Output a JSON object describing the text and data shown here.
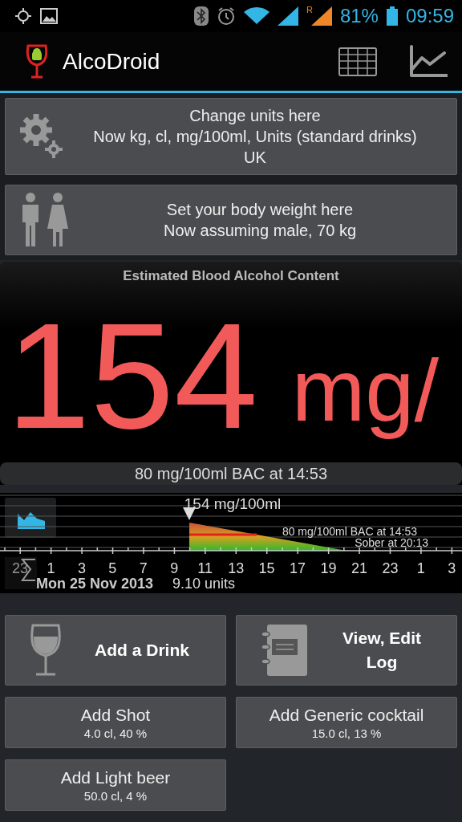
{
  "status_bar": {
    "roaming_mark": "R",
    "battery": "81%",
    "time": "09:59"
  },
  "action_bar": {
    "title": "AlcoDroid"
  },
  "settings": [
    {
      "kind": "units",
      "lines": [
        "Change units here",
        "Now kg, cl, mg/100ml, Units (standard drinks)",
        "UK"
      ]
    },
    {
      "kind": "body",
      "lines": [
        "Set your body weight here",
        "Now assuming male, 70 kg"
      ]
    }
  ],
  "bac": {
    "title": "Estimated Blood Alcohol Content",
    "value": "154",
    "unit": "mg/",
    "footer": "80 mg/100ml BAC at 14:53"
  },
  "timeline": {
    "peak_label": "154 mg/100ml",
    "limit_label": "80 mg/100ml BAC at 14:53",
    "sober_label": "Sober at 20:13",
    "hours": [
      "23",
      "1",
      "3",
      "5",
      "7",
      "9",
      "11",
      "13",
      "15",
      "17",
      "19",
      "21",
      "23",
      "1",
      "3"
    ],
    "date": "Mon 25 Nov 2013",
    "units": "9.10 units"
  },
  "actions": [
    {
      "kind": "drink",
      "label": "Add a Drink"
    },
    {
      "kind": "log",
      "label": "View, Edit Log"
    }
  ],
  "presets": [
    {
      "name": "Add Shot",
      "detail": "4.0 cl, 40 %"
    },
    {
      "name": "Add Generic cocktail",
      "detail": "15.0 cl, 13 %"
    },
    {
      "name": "Add Light beer",
      "detail": "50.0 cl, 4 %"
    }
  ]
}
